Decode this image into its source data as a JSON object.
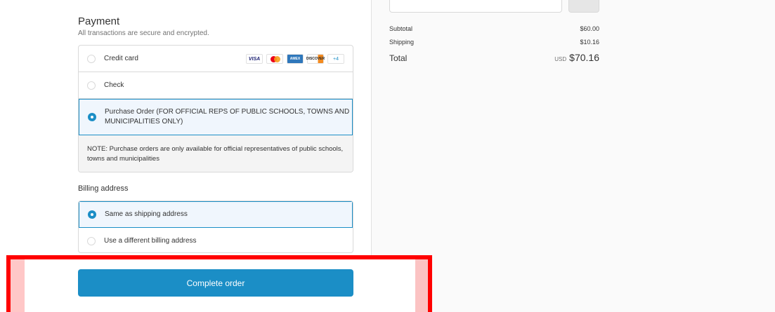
{
  "payment": {
    "title": "Payment",
    "subtitle": "All transactions are secure and encrypted.",
    "options": [
      {
        "label": "Credit card",
        "selected": false
      },
      {
        "label": "Check",
        "selected": false
      },
      {
        "label": "Purchase Order (FOR OFFICIAL REPS OF PUBLIC SCHOOLS, TOWNS AND MUNICIPALITIES ONLY)",
        "selected": true
      }
    ],
    "card_brands": [
      "VISA",
      "Mastercard",
      "AMEX",
      "DISCOVER"
    ],
    "more_cards": "+4",
    "note": "NOTE: Purchase orders are only available for official representatives of public schools, towns and municipalities"
  },
  "billing": {
    "title": "Billing address",
    "options": [
      {
        "label": "Same as shipping address",
        "selected": true
      },
      {
        "label": "Use a different billing address",
        "selected": false
      }
    ]
  },
  "cta": {
    "label": "Complete order"
  },
  "summary": {
    "subtotal_label": "Subtotal",
    "subtotal_value": "$60.00",
    "shipping_label": "Shipping",
    "shipping_value": "$10.16",
    "total_label": "Total",
    "currency": "USD",
    "total_value": "$70.16"
  },
  "colors": {
    "accent": "#1b8ec6",
    "highlight": "#ff0000"
  }
}
